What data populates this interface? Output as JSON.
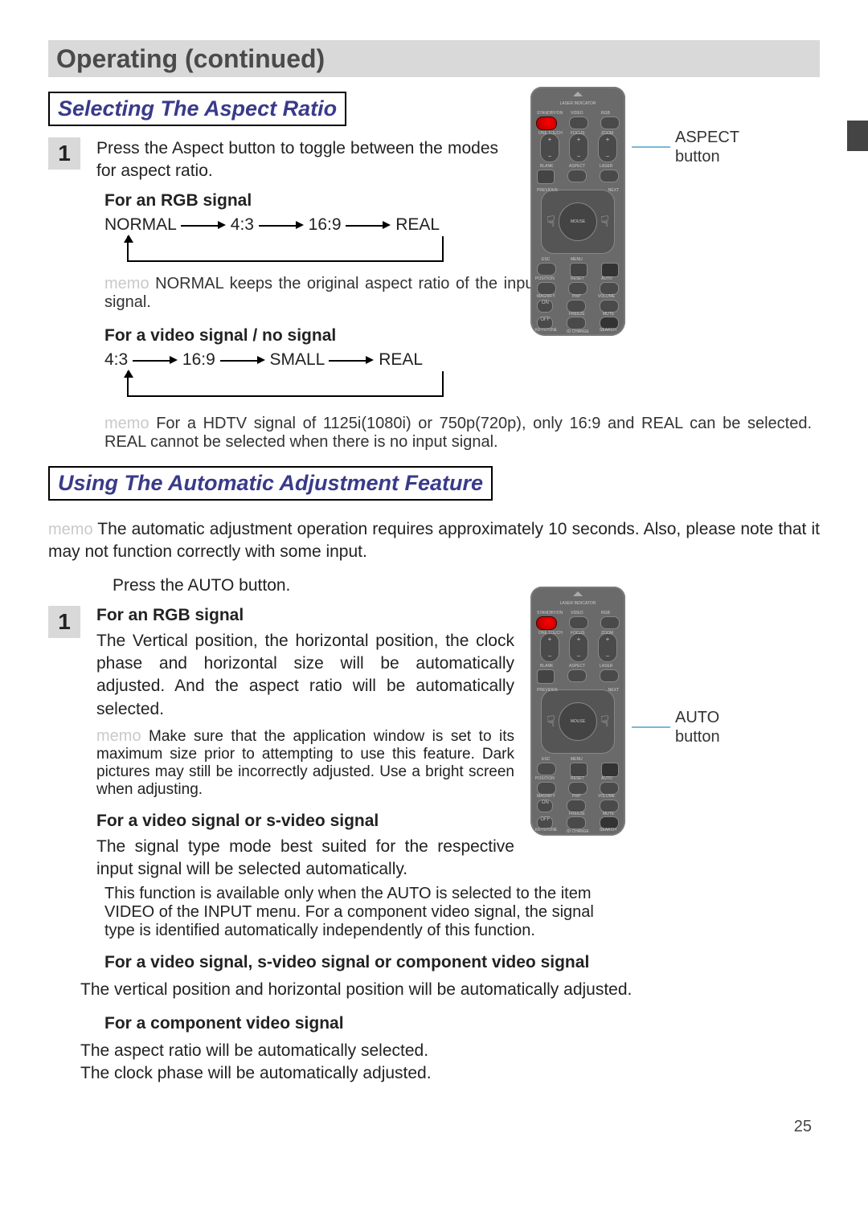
{
  "title": "Operating (continued)",
  "page_number": "25",
  "section1": {
    "heading": "Selecting The Aspect Ratio",
    "step_num": "1",
    "step_text": "Press the Aspect button to toggle between the modes for aspect ratio.",
    "sub1_heading": "For an RGB signal",
    "flow1": {
      "a": "NORMAL",
      "b": "4:3",
      "c": "16:9",
      "d": "REAL"
    },
    "memo1_label": "memo",
    "memo1_text": " NORMAL keeps the original aspect ratio of the input signal.",
    "sub2_heading": "For a video signal / no signal",
    "flow2": {
      "a": "4:3",
      "b": "16:9",
      "c": "SMALL",
      "d": "REAL"
    },
    "memo2_label": "memo",
    "memo2_text": " For a HDTV signal of 1125i(1080i) or 750p(720p), only 16:9 and REAL can be selected. REAL cannot be selected when there is no input signal.",
    "callout": "ASPECT button"
  },
  "section2": {
    "heading": "Using The Automatic Adjustment Feature",
    "memo_intro_label": "memo",
    "memo_intro_text": " The automatic adjustment operation requires approximately 10 seconds. Also, please note that it may not function correctly with some input.",
    "step_num": "1",
    "step_intro": "Press the AUTO button.",
    "sub1_heading": "For an RGB signal",
    "sub1_text": "The Vertical position, the horizontal position, the clock phase and horizontal size will be automatically adjusted. And the aspect ratio will be automatically selected.",
    "sub1_memo_label": "memo",
    "sub1_memo_text": " Make sure that the application window is set to its maximum size prior to attempting to use this feature. Dark pictures may still be incorrectly adjusted. Use a bright screen when adjusting.",
    "sub2_heading": "For a video signal or s-video signal",
    "sub2_text": "The signal type mode best suited for the respective input signal will be selected automatically.",
    "sub2_note": "This function is available only when the AUTO is selected to the item VIDEO of the INPUT menu. For a component video signal, the signal type is identified automatically independently of this function.",
    "sub3_heading": "For a video signal, s-video signal or component video signal",
    "sub3_text": "The vertical position and horizontal position will be automatically adjusted.",
    "sub4_heading": "For a component video signal",
    "sub4_text1": "The aspect ratio will be automatically selected.",
    "sub4_text2": "The clock phase will be automatically adjusted.",
    "callout": "AUTO button"
  },
  "remote": {
    "row1": {
      "a": "STANDBY/ON",
      "b": "VIDEO",
      "c": "RGB"
    },
    "row2": {
      "a": "ONE TOUCH",
      "b": "FOCUS",
      "c": "ZOOM"
    },
    "row3": {
      "a": "BLANK",
      "b": "ASPECT",
      "c": "LASER"
    },
    "pad": {
      "left": "PREVIOUS",
      "right": "NEXT",
      "center": "MOUSE"
    },
    "rowA": {
      "a": "ESC",
      "b": "MENU",
      "c": ""
    },
    "rowB": {
      "a": "POSITION",
      "b": "RESET",
      "c": "AUTO"
    },
    "rowC": {
      "a": "MAGNIFY",
      "b": "PinP",
      "c": "VOLUME"
    },
    "rowD": {
      "a": "",
      "b": "FREEZE",
      "c": "MUTE"
    },
    "rowE": {
      "a": "KEYSTONE",
      "b": "",
      "c": "SEARCH"
    },
    "bottom": "ID CHANGE"
  }
}
